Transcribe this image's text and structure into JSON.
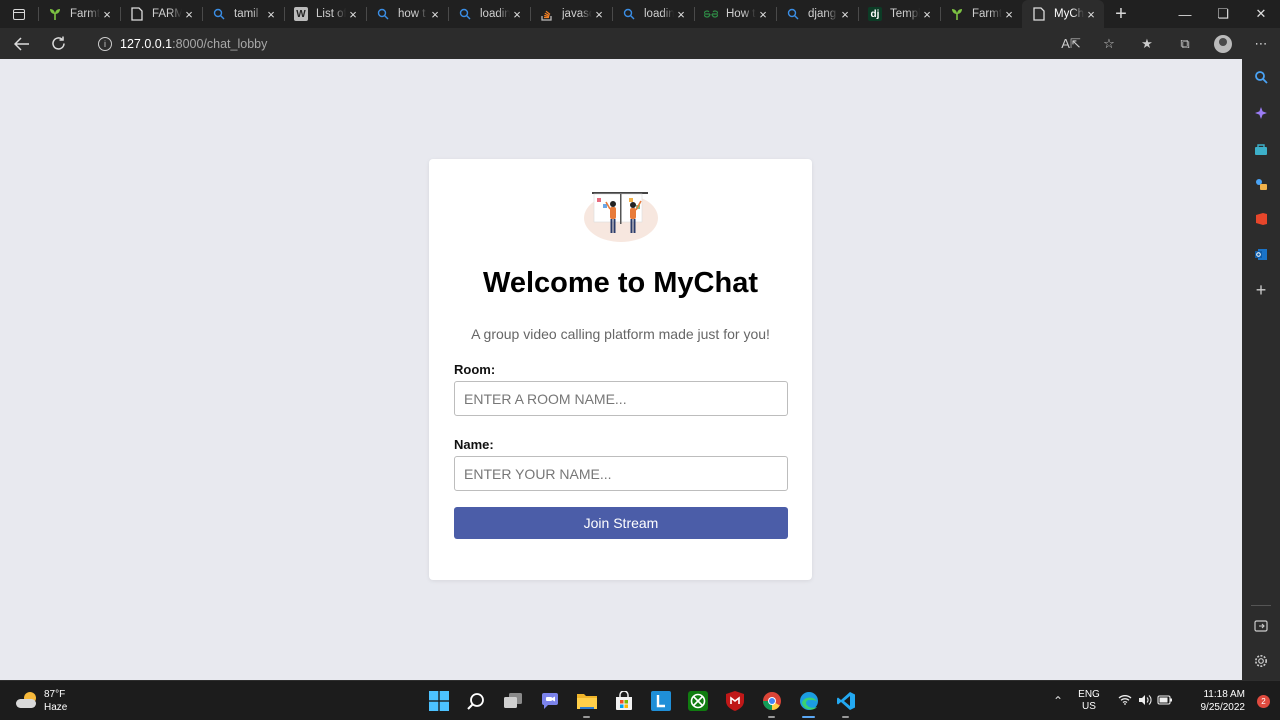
{
  "browser": {
    "tabs": [
      {
        "title": "Farmt",
        "icon": "sprout-icon",
        "active": false
      },
      {
        "title": "FARM",
        "icon": "page-icon",
        "active": false
      },
      {
        "title": "tamil",
        "icon": "search-icon",
        "active": false
      },
      {
        "title": "List of",
        "icon": "wikipedia-icon",
        "active": false
      },
      {
        "title": "how t",
        "icon": "search-icon",
        "active": false
      },
      {
        "title": "loadin",
        "icon": "search-icon",
        "active": false
      },
      {
        "title": "javasc",
        "icon": "stackoverflow-icon",
        "active": false
      },
      {
        "title": "loadin",
        "icon": "search-icon",
        "active": false
      },
      {
        "title": "How t",
        "icon": "geeks-icon",
        "active": false
      },
      {
        "title": "djang",
        "icon": "search-icon",
        "active": false
      },
      {
        "title": "Templ",
        "icon": "django-icon",
        "active": false
      },
      {
        "title": "Farmt",
        "icon": "sprout-icon",
        "active": false
      },
      {
        "title": "MyCh",
        "icon": "page-icon",
        "active": true
      }
    ],
    "url_host": "127.0.0.1",
    "url_path": ":8000/chat_lobby",
    "django_label": "dj",
    "wiki_label": "W"
  },
  "page": {
    "title": "Welcome to MyChat",
    "subtitle": "A group video calling platform made just for you!",
    "room_label": "Room:",
    "room_placeholder": "ENTER A ROOM NAME...",
    "name_label": "Name:",
    "name_placeholder": "ENTER YOUR NAME...",
    "join_button": "Join Stream",
    "accent_color": "#4b5da8"
  },
  "taskbar": {
    "weather_temp": "87°F",
    "weather_desc": "Haze",
    "lang_1": "ENG",
    "lang_2": "US",
    "time": "11:18 AM",
    "date": "9/25/2022",
    "notification_count": "2"
  }
}
